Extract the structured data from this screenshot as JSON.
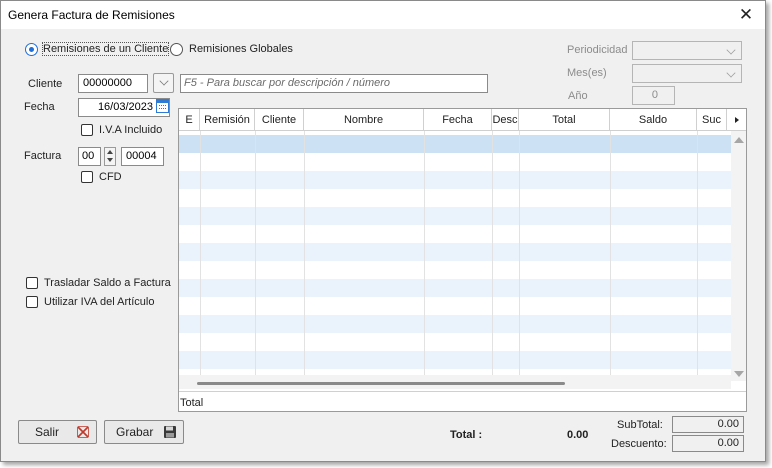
{
  "window": {
    "title": "Genera Factura de Remisiones"
  },
  "mode": {
    "option_cliente": "Remisiones de un Cliente",
    "option_globales": "Remisiones Globales"
  },
  "periodicidad": {
    "label": "Periodicidad",
    "value": ""
  },
  "meses": {
    "label": "Mes(es)",
    "value": ""
  },
  "anio": {
    "label": "Año",
    "value": "0"
  },
  "cliente": {
    "label": "Cliente",
    "value": "00000000"
  },
  "search": {
    "placeholder": "F5 - Para buscar por descripción / número"
  },
  "fecha": {
    "label": "Fecha",
    "value": "16/03/2023"
  },
  "iva_incluido": {
    "label": "I.V.A Incluido"
  },
  "factura": {
    "label": "Factura",
    "serie": "00",
    "numero": "00004"
  },
  "cfd": {
    "label": "CFD"
  },
  "trasladar": {
    "label": "Trasladar Saldo a Factura"
  },
  "utilizar_iva": {
    "label": "Utilizar IVA del Artículo"
  },
  "grid": {
    "columns": [
      "E",
      "Remisión",
      "Cliente",
      "Nombre",
      "Fecha",
      "Desc",
      "Total",
      "Saldo",
      "Suc"
    ],
    "footer_label": "Total"
  },
  "buttons": {
    "salir": "Salir",
    "grabar": "Grabar"
  },
  "totals": {
    "total_label": "Total :",
    "total_value": "0.00",
    "subtotal_label": "SubTotal:",
    "subtotal_value": "0.00",
    "descuento_label": "Descuento:",
    "descuento_value": "0.00"
  },
  "colors": {
    "accent": "#1e6fd9",
    "row_alt": "#eaf2fb",
    "row_selected": "#cde1f5"
  }
}
